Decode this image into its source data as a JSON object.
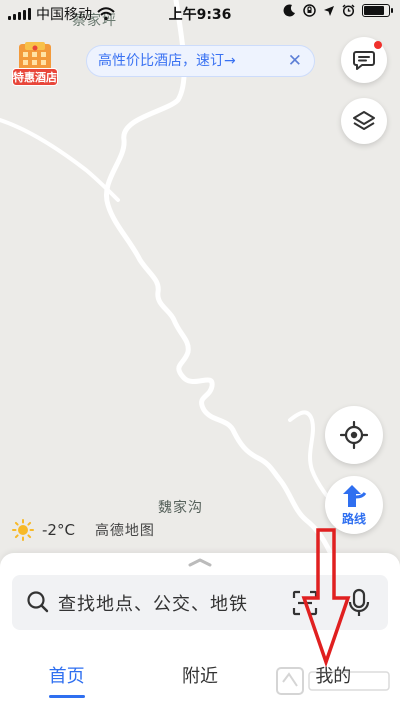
{
  "status_bar": {
    "carrier": "中国移动",
    "time": "上午9:36",
    "battery_level": 0.85
  },
  "map": {
    "labels": {
      "top_village": "蔡家坪",
      "village": "魏家沟"
    },
    "colors": {
      "background": "#ecebe8",
      "road": "#ffffff"
    }
  },
  "promo": {
    "label": "特惠酒店",
    "icon": "hotel-building-icon"
  },
  "hotel_banner": {
    "text": "高性价比酒店，速订→",
    "close": "✕"
  },
  "map_controls": {
    "message_icon": "message-icon",
    "layers_icon": "layers-icon",
    "locate_icon": "locate-icon",
    "route_label": "路线"
  },
  "weather": {
    "icon": "sun-icon",
    "temperature": "-2°C",
    "brand": "高德地图"
  },
  "search": {
    "placeholder": "查找地点、公交、地铁",
    "scan_icon": "scan-icon",
    "voice_icon": "microphone-icon"
  },
  "tabs": [
    {
      "label": "首页",
      "active": true
    },
    {
      "label": "附近",
      "active": false
    },
    {
      "label": "我的",
      "active": false
    }
  ],
  "accent_color": "#2f6ff0"
}
